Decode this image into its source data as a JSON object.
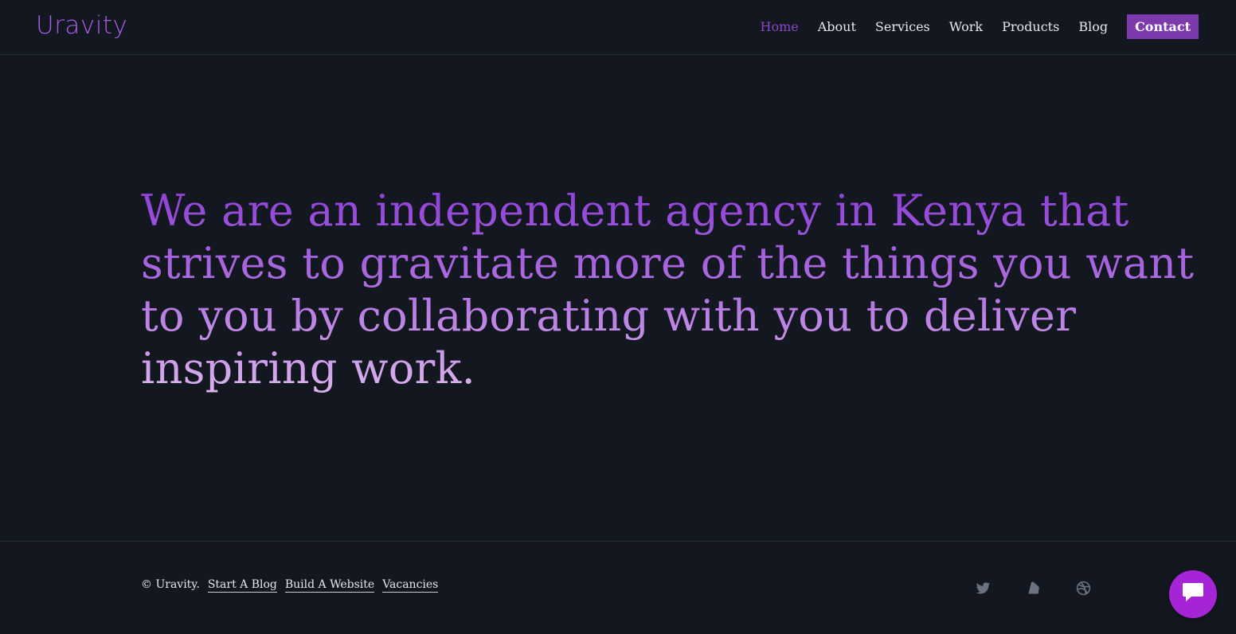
{
  "header": {
    "logo": "Uravity",
    "nav": [
      {
        "label": "Home",
        "active": true
      },
      {
        "label": "About"
      },
      {
        "label": "Services"
      },
      {
        "label": "Work"
      },
      {
        "label": "Products"
      },
      {
        "label": "Blog"
      },
      {
        "label": "Contact",
        "style": "button"
      }
    ]
  },
  "hero": {
    "headline": "We are an independent agency in Kenya that strives to gravitate more of the things you want to you by collaborating with you to deliver inspiring work."
  },
  "footer": {
    "copyright": "© Uravity.",
    "links": [
      "Start A Blog",
      "Build A Website",
      "Vacancies"
    ],
    "social_icons": [
      "twitter-icon",
      "medium-icon",
      "dribbble-icon"
    ]
  },
  "chat": {
    "icon": "chat-bubble-icon"
  },
  "colors": {
    "background": "#131820",
    "accent": "#7c3aad",
    "active_nav": "#8a46c8",
    "chat_button": "#a524d6"
  }
}
